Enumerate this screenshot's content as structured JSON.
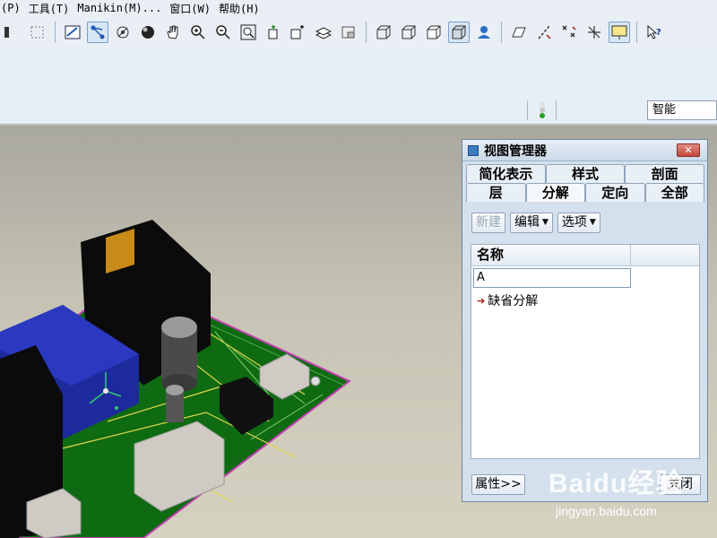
{
  "menubar": {
    "items": [
      "(P)",
      "工具(T)",
      "Manikin(M)...",
      "窗口(W)",
      "帮助(H)"
    ]
  },
  "toolbar": {
    "groups": [
      [
        "disk-icon",
        "select-rect-icon"
      ],
      [
        "sketch-icon",
        "spin-center-icon",
        "orient-icon",
        "shade-ball-icon",
        "pan-hand-icon",
        "zoom-in-icon",
        "zoom-out-icon",
        "zoom-fit-icon",
        "repaint-icon",
        "view-manager-icon",
        "layers-icon",
        "saved-views-icon"
      ],
      [
        "wireframe-icon",
        "hidden-line-icon",
        "no-hidden-icon",
        "shaded-icon",
        "appearance-icon"
      ],
      [
        "datum-plane-icon",
        "datum-axis-icon",
        "datum-point-icon",
        "coord-sys-icon",
        "annotation-icon"
      ],
      [
        "help-icon"
      ]
    ],
    "active": [
      "spin-center-icon",
      "shaded-icon",
      "annotation-icon"
    ]
  },
  "smart_filter": {
    "value": "智能"
  },
  "dialog": {
    "title": "视图管理器",
    "close_label": "✕",
    "tabs_row1": [
      "简化表示",
      "样式",
      "剖面"
    ],
    "tabs_row2": [
      "层",
      "分解",
      "定向",
      "全部"
    ],
    "active_tab": "分解",
    "buttons": {
      "new": "新建",
      "edit": "编辑",
      "options": "选项"
    },
    "list": {
      "header": "名称",
      "input_value": "A",
      "items": [
        "缺省分解"
      ]
    },
    "footer": {
      "properties": "属性>>",
      "close": "关闭"
    }
  },
  "watermark": {
    "main": "Baidu经验",
    "sub": "jingyan.baidu.com"
  }
}
